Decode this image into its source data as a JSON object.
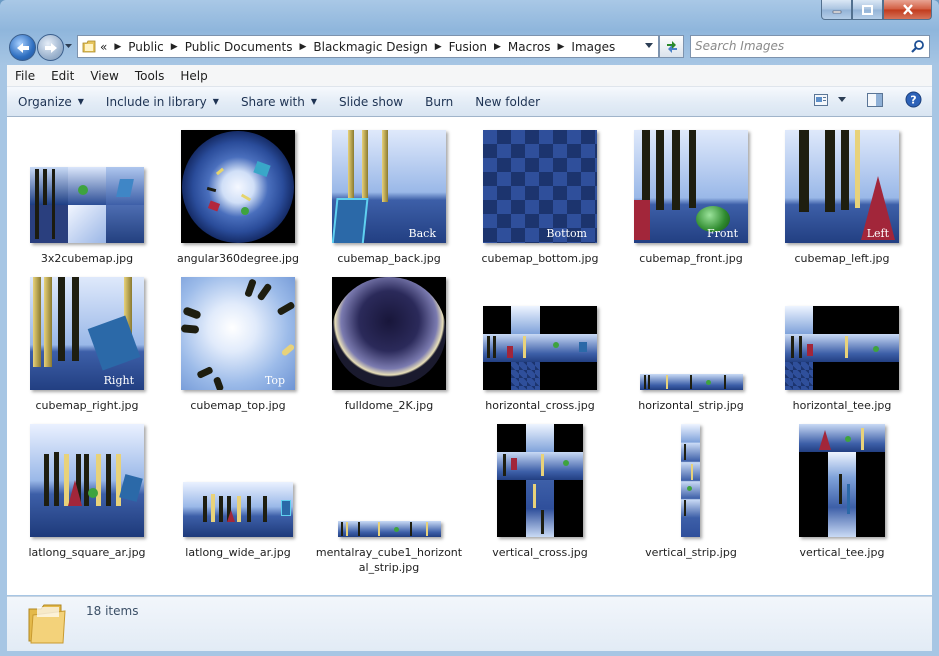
{
  "window": {
    "controls": [
      "minimize-icon",
      "maximize-icon",
      "close-icon"
    ]
  },
  "address": {
    "overflow": "«",
    "crumbs": [
      "Public",
      "Public Documents",
      "Blackmagic Design",
      "Fusion",
      "Macros",
      "Images"
    ],
    "search_placeholder": "Search Images"
  },
  "menu": [
    "File",
    "Edit",
    "View",
    "Tools",
    "Help"
  ],
  "toolbar": {
    "organize": "Organize",
    "include": "Include in library",
    "share": "Share with",
    "slideshow": "Slide show",
    "burn": "Burn",
    "newfolder": "New folder"
  },
  "files": [
    {
      "name": "3x2cubemap.jpg",
      "label": ""
    },
    {
      "name": "angular360degree.jpg",
      "label": ""
    },
    {
      "name": "cubemap_back.jpg",
      "label": "Back"
    },
    {
      "name": "cubemap_bottom.jpg",
      "label": "Bottom"
    },
    {
      "name": "cubemap_front.jpg",
      "label": "Front"
    },
    {
      "name": "cubemap_left.jpg",
      "label": "Left"
    },
    {
      "name": "cubemap_right.jpg",
      "label": "Right"
    },
    {
      "name": "cubemap_top.jpg",
      "label": "Top"
    },
    {
      "name": "fulldome_2K.jpg",
      "label": ""
    },
    {
      "name": "horizontal_cross.jpg",
      "label": ""
    },
    {
      "name": "horizontal_strip.jpg",
      "label": ""
    },
    {
      "name": "horizontal_tee.jpg",
      "label": ""
    },
    {
      "name": "latlong_square_ar.jpg",
      "label": ""
    },
    {
      "name": "latlong_wide_ar.jpg",
      "label": ""
    },
    {
      "name": "mentalray_cube1_horizontal_strip.jpg",
      "label": ""
    },
    {
      "name": "vertical_cross.jpg",
      "label": ""
    },
    {
      "name": "vertical_strip.jpg",
      "label": ""
    },
    {
      "name": "vertical_tee.jpg",
      "label": ""
    }
  ],
  "status": {
    "count": "18 items"
  },
  "colors": {
    "scene_sky": "#b9cdf0",
    "scene_floor": "#3d5fa8",
    "pillar": "#e8d27a",
    "accent_blue": "#2f6fc0"
  }
}
